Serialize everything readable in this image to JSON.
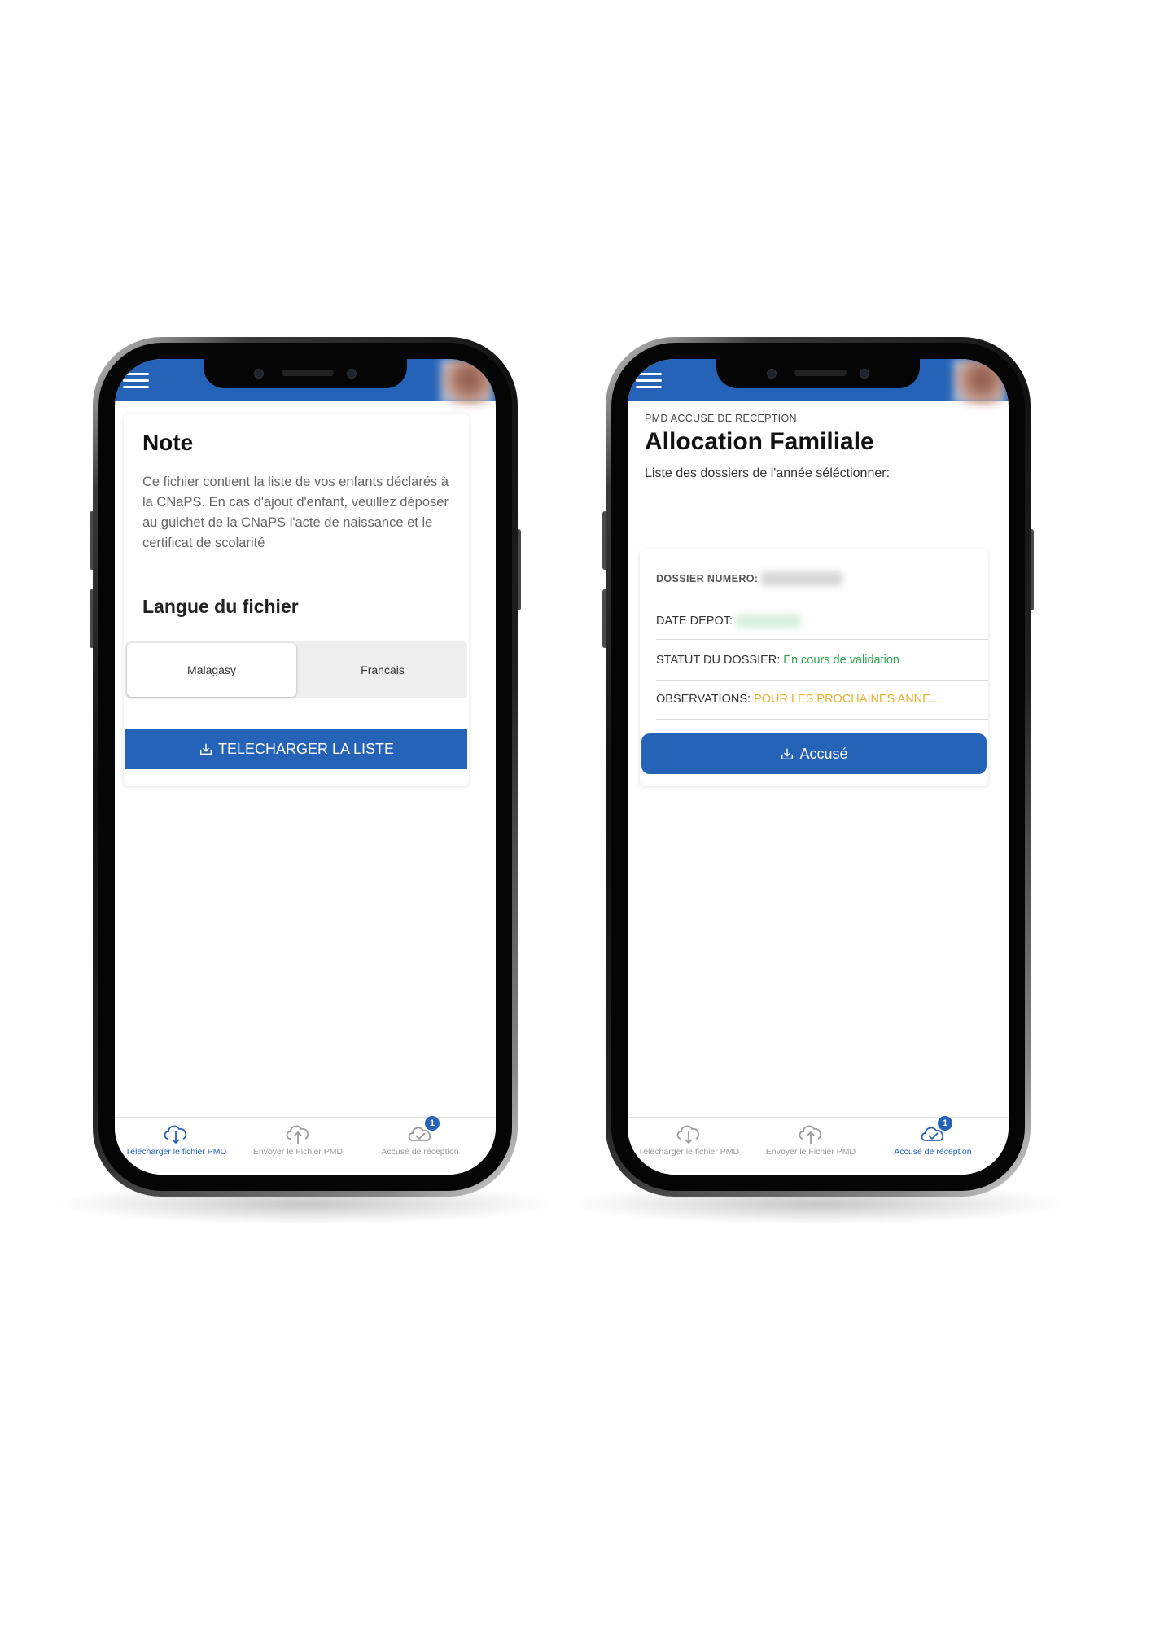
{
  "left_screen": {
    "note": {
      "title": "Note",
      "body": "Ce fichier contient la liste de vos enfants déclarés à la CNaPS. En cas d'ajout d'enfant, veuillez déposer au guichet de la CNaPS l'acte de naissance et le certificat de scolarité"
    },
    "language": {
      "title": "Langue du fichier",
      "options": [
        "Malagasy",
        "Francais"
      ],
      "selected": "Malagasy"
    },
    "download_button": "TELECHARGER LA LISTE",
    "bottom_nav": {
      "items": [
        {
          "label": "Télécharger le fichier PMD",
          "icon": "cloud-download-icon",
          "active": true
        },
        {
          "label": "Envoyer le Fichier PMD",
          "icon": "cloud-upload-icon",
          "active": false
        },
        {
          "label": "Accusé de réception",
          "icon": "cloud-check-icon",
          "active": false,
          "badge": "1"
        }
      ]
    }
  },
  "right_screen": {
    "eyebrow": "PMD ACCUSE DE RECEPTION",
    "title": "Allocation Familiale",
    "subtitle": "Liste des dossiers de l'année séléctionner:",
    "dossier": {
      "numero_label": "DOSSIER NUMERO:",
      "date_label": "DATE DEPOT:",
      "statut_label": "STATUT DU DOSSIER:",
      "statut_value": "En cours de validation",
      "observations_label": "OBSERVATIONS:",
      "observations_value": "POUR LES PROCHAINES ANNE..."
    },
    "accuse_button": "Accusé",
    "bottom_nav": {
      "items": [
        {
          "label": "Télécharger le fichier PMD",
          "icon": "cloud-download-icon",
          "active": false
        },
        {
          "label": "Envoyer le Fichier PMD",
          "icon": "cloud-upload-icon",
          "active": false
        },
        {
          "label": "Accusé de réception",
          "icon": "cloud-check-icon",
          "active": true,
          "badge": "1"
        }
      ]
    }
  },
  "colors": {
    "primary": "#2563b8",
    "status_green": "#2ea84f",
    "observation_orange": "#e8b030"
  }
}
